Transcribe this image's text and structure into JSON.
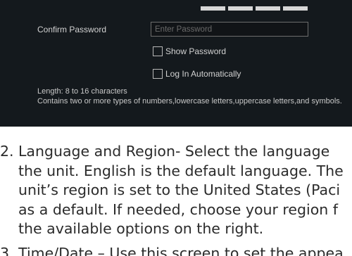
{
  "form": {
    "confirm_label": "Confirm Password",
    "confirm_placeholder": "Enter Password",
    "show_password_label": "Show Password",
    "auto_login_label": "Log In Automatically",
    "hint_length": "Length: 8 to 16 characters",
    "hint_types": "Contains two or more types of numbers,lowercase letters,uppercase letters,and symbols."
  },
  "doc": {
    "item_number": "2.",
    "lines": [
      "Language and Region- Select the language",
      "the unit. English is the default language. The",
      "unit’s region is set to the United States (Paci",
      "as a default. If needed, choose your region f",
      "the  available options on the right."
    ],
    "next_item_partial": "3. Time/Date – Use this screen to set the appea"
  },
  "colors": {
    "panel_bg": "#14191d",
    "text_dark": "#2b2b2b"
  }
}
